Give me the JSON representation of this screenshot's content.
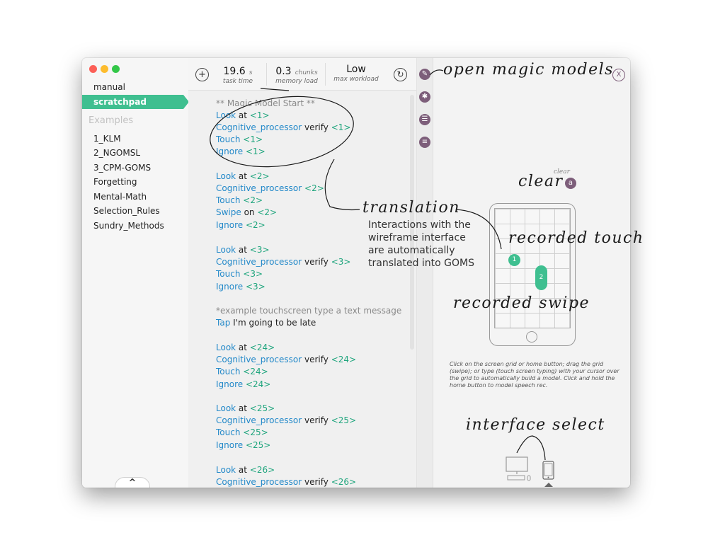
{
  "sidebar": {
    "items_top": [
      "manual",
      "scratchpad"
    ],
    "examples_heading": "Examples",
    "examples": [
      "1_KLM",
      "2_NGOMSL",
      "3_CPM-GOMS",
      "Forgetting",
      "Mental-Math",
      "Selection_Rules",
      "Sundry_Methods"
    ],
    "collapse_label": "^"
  },
  "toolbar": {
    "add_label": "+",
    "task_time_value": "19.6",
    "task_time_unit": "s",
    "task_time_label": "task time",
    "memory_value": "0.3",
    "memory_unit": "chunks",
    "memory_label": "memory load",
    "workload_value": "Low",
    "workload_label": "max workload",
    "refresh_label": "↻"
  },
  "code": {
    "l1": "** Magic Model Start **",
    "l2a": "Look",
    "l2b": " at ",
    "l2c": "<1>",
    "l3a": "Cognitive_processor",
    "l3b": " verify ",
    "l3c": "<1>",
    "l4a": "Touch",
    "l4b": " ",
    "l4c": "<1>",
    "l5a": "Ignore",
    "l5b": " ",
    "l5c": "<1>",
    "l6a": "Look",
    "l6b": " at ",
    "l6c": "<2>",
    "l7a": "Cognitive_processor",
    "l7b": " ",
    "l7c": "<2>",
    "l8a": "Touch",
    "l8b": " ",
    "l8c": "<2>",
    "l9a": "Swipe",
    "l9b": " on ",
    "l9c": "<2>",
    "l10a": "Ignore",
    "l10b": " ",
    "l10c": "<2>",
    "l11a": "Look",
    "l11b": " at ",
    "l11c": "<3>",
    "l12a": "Cognitive_processor",
    "l12b": " verify ",
    "l12c": "<3>",
    "l13a": "Touch",
    "l13b": " ",
    "l13c": "<3>",
    "l14a": "Ignore",
    "l14b": " ",
    "l14c": "<3>",
    "l15": "*example touchscreen type a text message",
    "l16a": "Tap",
    "l16b": " I'm going to be late",
    "l17a": "Look",
    "l17b": " at ",
    "l17c": "<24>",
    "l18a": "Cognitive_processor",
    "l18b": " verify ",
    "l18c": "<24>",
    "l19a": "Touch",
    "l19b": " ",
    "l19c": "<24>",
    "l20a": "Ignore",
    "l20b": " ",
    "l20c": "<24>",
    "l21a": "Look",
    "l21b": " at ",
    "l21c": "<25>",
    "l22a": "Cognitive_processor",
    "l22b": " verify ",
    "l22c": "<25>",
    "l23a": "Touch",
    "l23b": " ",
    "l23c": "<25>",
    "l24a": "Ignore",
    "l24b": " ",
    "l24c": "<25>",
    "l25a": "Look",
    "l25b": " at ",
    "l25c": "<26>",
    "l26a": "Cognitive_processor",
    "l26b": " verify ",
    "l26c": "<26>"
  },
  "right_panel": {
    "tool_icons": [
      "pencil-icon",
      "asterisk-icon",
      "list-icon",
      "align-icon"
    ],
    "close_label": "X",
    "clear_label": "a",
    "touch_number": "1",
    "swipe_number": "2",
    "instructions": "Click on the screen grid or home button; drag the grid (swipe); or type (touch screen typing) with your cursor over the grid to automatically build a model. Click and hold the home button to model speech rec."
  },
  "annotations": {
    "open_magic_models": "open magic models",
    "clear_small": "clear",
    "clear_big": "clear",
    "translation": "translation",
    "translation_body": "Interactions with the wireframe interface are automatically translated into GOMS",
    "recorded_touch": "recorded touch",
    "recorded_swipe": "recorded swipe",
    "interface_select": "interface select"
  },
  "colors": {
    "accent_green": "#3fbf90",
    "keyword_blue": "#2389c9",
    "arg_green": "#1fa57d",
    "tool_purple": "#7d5e7a"
  }
}
